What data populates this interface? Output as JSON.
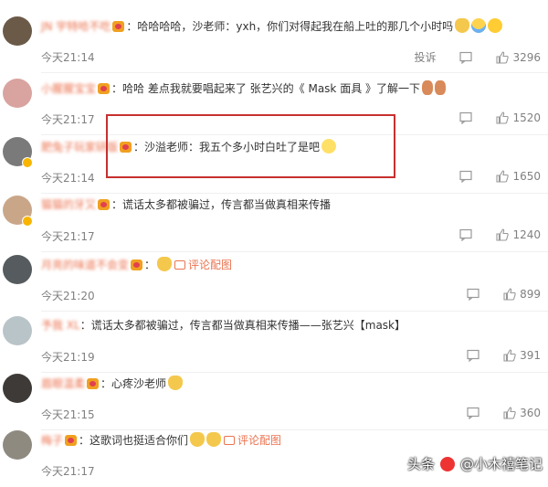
{
  "comments": [
    {
      "username": "JN 宇特哈不吃",
      "text": "哈哈哈哈，沙老师：yxh，你们对得起我在船上吐的那几个小时吗",
      "time": "今天21:14",
      "report": "投诉",
      "likes": "3296",
      "avatar_color": "#6b5a48"
    },
    {
      "username": "小腥腥宝宝",
      "text": "哈哈 差点我就要唱起来了 张艺兴的《 Mask 面具 》了解一下",
      "time": "今天21:17",
      "likes": "1520",
      "avatar_color": "#d9a3a0"
    },
    {
      "username": "肥兔子玩家研版",
      "text": "沙溢老师：我五个多小时白吐了是吧",
      "time": "今天21:14",
      "likes": "1650",
      "avatar_color": "#7a7a7a"
    },
    {
      "username": "猫猫的牙又",
      "text": "谎话太多都被骗过，传言都当做真相来传播",
      "time": "今天21:17",
      "likes": "1240",
      "avatar_color": "#caa689"
    },
    {
      "username": "月亮的味道不会变",
      "text": "",
      "picture_comment": "评论配图",
      "time": "今天21:20",
      "likes": "899",
      "avatar_color": "#555b5e"
    },
    {
      "username": "予我 XL",
      "text": "谎话太多都被骗过，传言都当做真相来传播——张艺兴【mask】",
      "time": "今天21:19",
      "likes": "391",
      "avatar_color": "#b9c4c9"
    },
    {
      "username": "眉眼温柔",
      "text": "心疼沙老师",
      "time": "今天21:15",
      "likes": "360",
      "avatar_color": "#3d3a38"
    },
    {
      "username": "梅子",
      "text": "这歌词也挺适合你们",
      "picture_comment": "评论配图",
      "time": "今天21:17",
      "likes": "",
      "avatar_color": "#8f8a80"
    }
  ],
  "watermark": {
    "brand": "头条",
    "account": "@小木禧笔记"
  },
  "colors": {
    "username": "#eb7350",
    "meta": "#808080",
    "highlight_box": "#c73030"
  }
}
